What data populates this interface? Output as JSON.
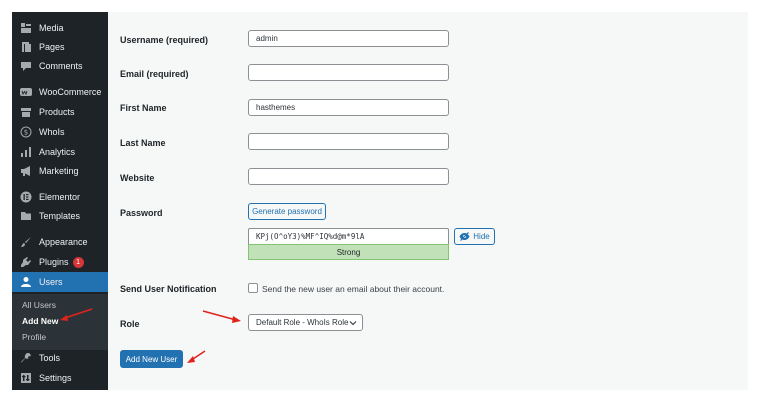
{
  "sidebar": {
    "items": [
      {
        "label": "Media",
        "icon": "media-icon"
      },
      {
        "label": "Pages",
        "icon": "pages-icon"
      },
      {
        "label": "Comments",
        "icon": "comments-icon"
      },
      {
        "label": "WooCommerce",
        "icon": "woocommerce-icon"
      },
      {
        "label": "Products",
        "icon": "products-icon"
      },
      {
        "label": "WhoIs",
        "icon": "dollar-icon"
      },
      {
        "label": "Analytics",
        "icon": "analytics-icon"
      },
      {
        "label": "Marketing",
        "icon": "megaphone-icon"
      },
      {
        "label": "Elementor",
        "icon": "elementor-icon"
      },
      {
        "label": "Templates",
        "icon": "folder-icon"
      },
      {
        "label": "Appearance",
        "icon": "brush-icon"
      },
      {
        "label": "Plugins",
        "icon": "plugin-icon",
        "badge": "1"
      },
      {
        "label": "Users",
        "icon": "users-icon"
      },
      {
        "label": "Tools",
        "icon": "wrench-icon"
      },
      {
        "label": "Settings",
        "icon": "settings-icon"
      }
    ],
    "submenu": [
      {
        "label": "All Users"
      },
      {
        "label": "Add New"
      },
      {
        "label": "Profile"
      }
    ],
    "active_color": "#2271b1",
    "badge_color": "#d63638"
  },
  "form": {
    "username": {
      "label": "Username (required)",
      "value": "admin"
    },
    "email": {
      "label": "Email (required)",
      "value": ""
    },
    "first_name": {
      "label": "First Name",
      "value": "hasthemes"
    },
    "last_name": {
      "label": "Last Name",
      "value": ""
    },
    "website": {
      "label": "Website",
      "value": ""
    },
    "password": {
      "label": "Password",
      "generate_label": "Generate password",
      "value": "KPj(O^oY3)%MF^IQ%d@m*9lA",
      "hide_label": "Hide",
      "strength": "Strong",
      "strength_color": "#c1e1b9"
    },
    "notification": {
      "label": "Send User Notification",
      "checkbox_label": "Send the new user an email about their account.",
      "checked": false
    },
    "role": {
      "label": "Role",
      "selected": "Default Role - WhoIs Role"
    },
    "submit_label": "Add New User"
  },
  "annotation_color": "#e0221b"
}
